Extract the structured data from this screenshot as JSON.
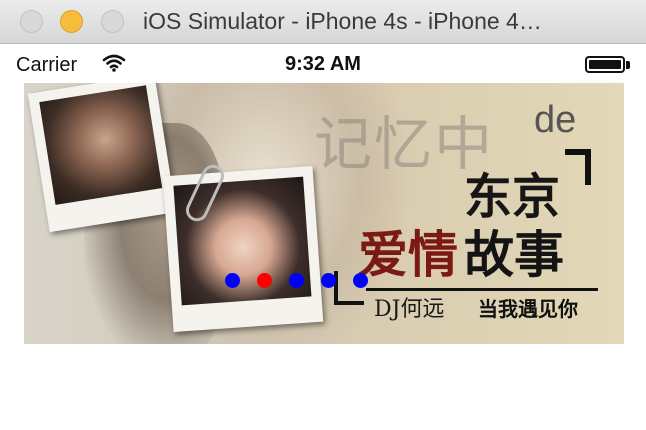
{
  "window": {
    "title": "iOS Simulator - iPhone 4s - iPhone 4…"
  },
  "statusbar": {
    "carrier": "Carrier",
    "time": "9:32 AM",
    "battery_level": 1.0
  },
  "banner": {
    "line_memory": "记忆中",
    "line_de": "de",
    "line_tokyo": "东京",
    "line_love_red": "爱情",
    "line_love_black": "故事",
    "dj": "DJ何远",
    "song": "当我遇见你"
  },
  "page_control": {
    "count": 5,
    "current_index": 1,
    "active_color": "#ff0000",
    "inactive_color": "#0000ff"
  }
}
